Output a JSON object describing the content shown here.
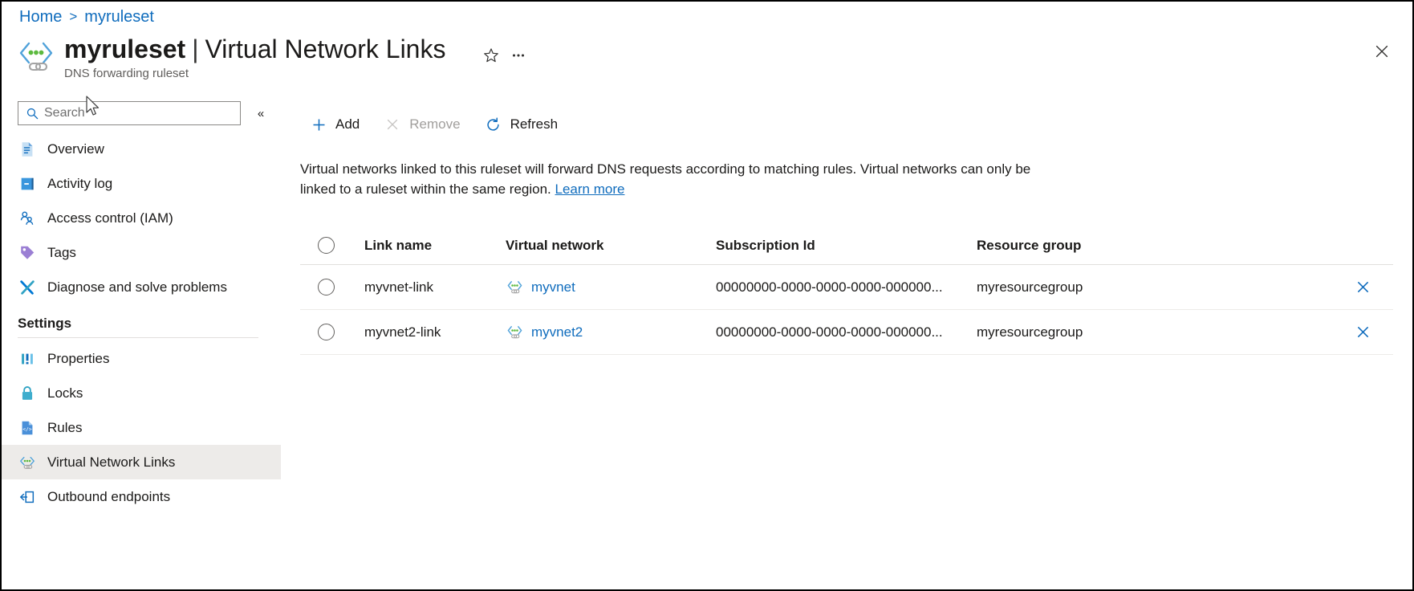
{
  "breadcrumb": {
    "home": "Home",
    "separator": ">",
    "current": "myruleset"
  },
  "header": {
    "resource_icon": "dns-forwarding-ruleset-icon",
    "title_resource": "myruleset",
    "title_divider": "|",
    "title_section": "Virtual Network Links",
    "subtitle": "DNS forwarding ruleset",
    "favorite_icon": "star-icon",
    "more_icon": "ellipsis-icon",
    "close_icon": "close-icon"
  },
  "sidebar": {
    "search": {
      "placeholder": "Search",
      "value": "",
      "icon": "search-icon"
    },
    "collapse_icon": "chevron-double-left-icon",
    "collapse_label": "«",
    "items": [
      {
        "label": "Overview",
        "icon": "overview-document-icon",
        "selected": false
      },
      {
        "label": "Activity log",
        "icon": "activity-log-icon",
        "selected": false
      },
      {
        "label": "Access control (IAM)",
        "icon": "access-control-people-icon",
        "selected": false
      },
      {
        "label": "Tags",
        "icon": "tag-icon",
        "selected": false
      },
      {
        "label": "Diagnose and solve problems",
        "icon": "diagnose-wrench-icon",
        "selected": false
      }
    ],
    "group_title": "Settings",
    "settings_items": [
      {
        "label": "Properties",
        "icon": "properties-bars-icon",
        "selected": false
      },
      {
        "label": "Locks",
        "icon": "lock-icon",
        "selected": false
      },
      {
        "label": "Rules",
        "icon": "rules-code-file-icon",
        "selected": false
      },
      {
        "label": "Virtual Network Links",
        "icon": "virtual-network-link-icon",
        "selected": true
      },
      {
        "label": "Outbound endpoints",
        "icon": "outbound-endpoint-icon",
        "selected": false
      }
    ]
  },
  "toolbar": {
    "add_label": "Add",
    "add_icon": "plus-icon",
    "remove_label": "Remove",
    "remove_icon": "cross-icon",
    "remove_disabled": true,
    "refresh_label": "Refresh",
    "refresh_icon": "refresh-icon"
  },
  "description": {
    "text": "Virtual networks linked to this ruleset will forward DNS requests according to matching rules. Virtual networks can only be linked to a ruleset within the same region. ",
    "link_label": "Learn more"
  },
  "table": {
    "columns": [
      {
        "key": "link_name",
        "label": "Link name"
      },
      {
        "key": "virtual_network",
        "label": "Virtual network"
      },
      {
        "key": "subscription_id",
        "label": "Subscription Id"
      },
      {
        "key": "resource_group",
        "label": "Resource group"
      }
    ],
    "select_all_icon": "radio-unchecked-icon",
    "rows": [
      {
        "selected": false,
        "link_name": "myvnet-link",
        "virtual_network": "myvnet",
        "virtual_network_icon": "virtual-network-icon",
        "subscription_id": "00000000-0000-0000-0000-000000...",
        "resource_group": "myresourcegroup",
        "delete_icon": "delete-x-icon"
      },
      {
        "selected": false,
        "link_name": "myvnet2-link",
        "virtual_network": "myvnet2",
        "virtual_network_icon": "virtual-network-icon",
        "subscription_id": "00000000-0000-0000-0000-000000...",
        "resource_group": "myresourcegroup",
        "delete_icon": "delete-x-icon"
      }
    ]
  },
  "colors": {
    "accent_blue": "#0f6cbd",
    "link_blue": "#0078d4",
    "text_primary": "#1b1a19",
    "text_secondary": "#605e5c",
    "disabled": "#a19f9d",
    "selected_row_bg": "#edebe9",
    "divider": "#e1dfdd",
    "green_dot": "#5dba3f"
  }
}
